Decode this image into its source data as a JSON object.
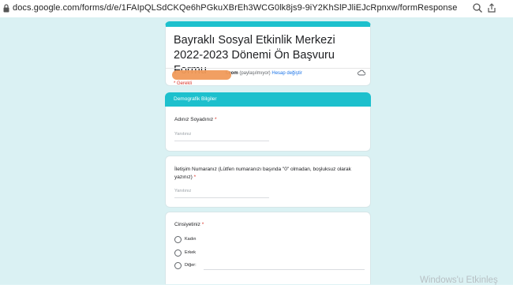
{
  "browser": {
    "url": "docs.google.com/forms/d/e/1FAIpQLSdCKQe6hPGkuXBrEh3WCG0lk8js9-9iY2KhSlPJliEJcRpnxw/formResponse",
    "icons": [
      "lock-icon",
      "zoom-icon",
      "share-icon"
    ]
  },
  "form": {
    "title": "Bayraklı Sosyal Etkinlik Merkezi 2022-2023 Dönemi Ön Başvuru Formu",
    "account_email_suffix": "l.com",
    "account_not_shared": "(paylaşılmıyor)",
    "switch_account": "Hesap değiştir",
    "required_note": "* Gerekli"
  },
  "section": {
    "title": "Demografik Bilgiler"
  },
  "questions": [
    {
      "label": "Adınız Soyadınız",
      "required": "*",
      "placeholder": "Yanıtınız"
    },
    {
      "label": "İletişim Numaranız (Lütfen numaranızı başında \"0\" olmadan, boşluksuz olarak yazınız)",
      "required": "*",
      "placeholder": "Yanıtınız"
    },
    {
      "label": "Cinsiyetiniz",
      "required": "*",
      "options": [
        "Kadın",
        "Erkek",
        "Diğer:"
      ]
    }
  ],
  "watermark": "Windows'u Etkinleş",
  "colors": {
    "accent": "#1dc0cd",
    "page_bg": "#daf1f3",
    "required": "#d93025",
    "link": "#1a73e8"
  }
}
